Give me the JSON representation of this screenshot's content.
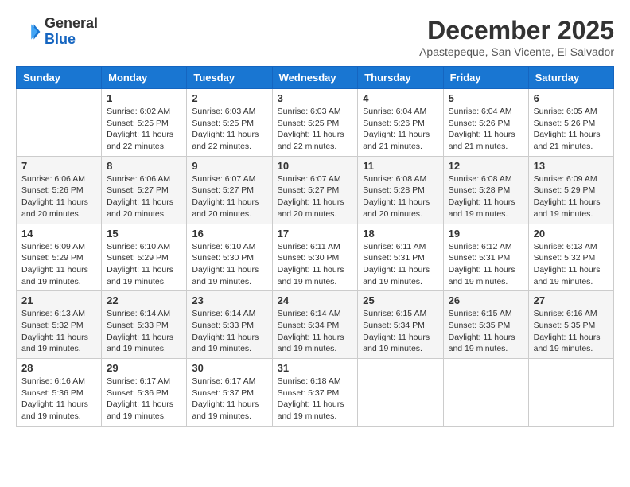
{
  "header": {
    "logo_general": "General",
    "logo_blue": "Blue",
    "month_title": "December 2025",
    "location": "Apastepeque, San Vicente, El Salvador"
  },
  "weekdays": [
    "Sunday",
    "Monday",
    "Tuesday",
    "Wednesday",
    "Thursday",
    "Friday",
    "Saturday"
  ],
  "weeks": [
    [
      {
        "day": "",
        "sunrise": "",
        "sunset": "",
        "daylight": ""
      },
      {
        "day": "1",
        "sunrise": "Sunrise: 6:02 AM",
        "sunset": "Sunset: 5:25 PM",
        "daylight": "Daylight: 11 hours and 22 minutes."
      },
      {
        "day": "2",
        "sunrise": "Sunrise: 6:03 AM",
        "sunset": "Sunset: 5:25 PM",
        "daylight": "Daylight: 11 hours and 22 minutes."
      },
      {
        "day": "3",
        "sunrise": "Sunrise: 6:03 AM",
        "sunset": "Sunset: 5:25 PM",
        "daylight": "Daylight: 11 hours and 22 minutes."
      },
      {
        "day": "4",
        "sunrise": "Sunrise: 6:04 AM",
        "sunset": "Sunset: 5:26 PM",
        "daylight": "Daylight: 11 hours and 21 minutes."
      },
      {
        "day": "5",
        "sunrise": "Sunrise: 6:04 AM",
        "sunset": "Sunset: 5:26 PM",
        "daylight": "Daylight: 11 hours and 21 minutes."
      },
      {
        "day": "6",
        "sunrise": "Sunrise: 6:05 AM",
        "sunset": "Sunset: 5:26 PM",
        "daylight": "Daylight: 11 hours and 21 minutes."
      }
    ],
    [
      {
        "day": "7",
        "sunrise": "Sunrise: 6:06 AM",
        "sunset": "Sunset: 5:26 PM",
        "daylight": "Daylight: 11 hours and 20 minutes."
      },
      {
        "day": "8",
        "sunrise": "Sunrise: 6:06 AM",
        "sunset": "Sunset: 5:27 PM",
        "daylight": "Daylight: 11 hours and 20 minutes."
      },
      {
        "day": "9",
        "sunrise": "Sunrise: 6:07 AM",
        "sunset": "Sunset: 5:27 PM",
        "daylight": "Daylight: 11 hours and 20 minutes."
      },
      {
        "day": "10",
        "sunrise": "Sunrise: 6:07 AM",
        "sunset": "Sunset: 5:27 PM",
        "daylight": "Daylight: 11 hours and 20 minutes."
      },
      {
        "day": "11",
        "sunrise": "Sunrise: 6:08 AM",
        "sunset": "Sunset: 5:28 PM",
        "daylight": "Daylight: 11 hours and 20 minutes."
      },
      {
        "day": "12",
        "sunrise": "Sunrise: 6:08 AM",
        "sunset": "Sunset: 5:28 PM",
        "daylight": "Daylight: 11 hours and 19 minutes."
      },
      {
        "day": "13",
        "sunrise": "Sunrise: 6:09 AM",
        "sunset": "Sunset: 5:29 PM",
        "daylight": "Daylight: 11 hours and 19 minutes."
      }
    ],
    [
      {
        "day": "14",
        "sunrise": "Sunrise: 6:09 AM",
        "sunset": "Sunset: 5:29 PM",
        "daylight": "Daylight: 11 hours and 19 minutes."
      },
      {
        "day": "15",
        "sunrise": "Sunrise: 6:10 AM",
        "sunset": "Sunset: 5:29 PM",
        "daylight": "Daylight: 11 hours and 19 minutes."
      },
      {
        "day": "16",
        "sunrise": "Sunrise: 6:10 AM",
        "sunset": "Sunset: 5:30 PM",
        "daylight": "Daylight: 11 hours and 19 minutes."
      },
      {
        "day": "17",
        "sunrise": "Sunrise: 6:11 AM",
        "sunset": "Sunset: 5:30 PM",
        "daylight": "Daylight: 11 hours and 19 minutes."
      },
      {
        "day": "18",
        "sunrise": "Sunrise: 6:11 AM",
        "sunset": "Sunset: 5:31 PM",
        "daylight": "Daylight: 11 hours and 19 minutes."
      },
      {
        "day": "19",
        "sunrise": "Sunrise: 6:12 AM",
        "sunset": "Sunset: 5:31 PM",
        "daylight": "Daylight: 11 hours and 19 minutes."
      },
      {
        "day": "20",
        "sunrise": "Sunrise: 6:13 AM",
        "sunset": "Sunset: 5:32 PM",
        "daylight": "Daylight: 11 hours and 19 minutes."
      }
    ],
    [
      {
        "day": "21",
        "sunrise": "Sunrise: 6:13 AM",
        "sunset": "Sunset: 5:32 PM",
        "daylight": "Daylight: 11 hours and 19 minutes."
      },
      {
        "day": "22",
        "sunrise": "Sunrise: 6:14 AM",
        "sunset": "Sunset: 5:33 PM",
        "daylight": "Daylight: 11 hours and 19 minutes."
      },
      {
        "day": "23",
        "sunrise": "Sunrise: 6:14 AM",
        "sunset": "Sunset: 5:33 PM",
        "daylight": "Daylight: 11 hours and 19 minutes."
      },
      {
        "day": "24",
        "sunrise": "Sunrise: 6:14 AM",
        "sunset": "Sunset: 5:34 PM",
        "daylight": "Daylight: 11 hours and 19 minutes."
      },
      {
        "day": "25",
        "sunrise": "Sunrise: 6:15 AM",
        "sunset": "Sunset: 5:34 PM",
        "daylight": "Daylight: 11 hours and 19 minutes."
      },
      {
        "day": "26",
        "sunrise": "Sunrise: 6:15 AM",
        "sunset": "Sunset: 5:35 PM",
        "daylight": "Daylight: 11 hours and 19 minutes."
      },
      {
        "day": "27",
        "sunrise": "Sunrise: 6:16 AM",
        "sunset": "Sunset: 5:35 PM",
        "daylight": "Daylight: 11 hours and 19 minutes."
      }
    ],
    [
      {
        "day": "28",
        "sunrise": "Sunrise: 6:16 AM",
        "sunset": "Sunset: 5:36 PM",
        "daylight": "Daylight: 11 hours and 19 minutes."
      },
      {
        "day": "29",
        "sunrise": "Sunrise: 6:17 AM",
        "sunset": "Sunset: 5:36 PM",
        "daylight": "Daylight: 11 hours and 19 minutes."
      },
      {
        "day": "30",
        "sunrise": "Sunrise: 6:17 AM",
        "sunset": "Sunset: 5:37 PM",
        "daylight": "Daylight: 11 hours and 19 minutes."
      },
      {
        "day": "31",
        "sunrise": "Sunrise: 6:18 AM",
        "sunset": "Sunset: 5:37 PM",
        "daylight": "Daylight: 11 hours and 19 minutes."
      },
      {
        "day": "",
        "sunrise": "",
        "sunset": "",
        "daylight": ""
      },
      {
        "day": "",
        "sunrise": "",
        "sunset": "",
        "daylight": ""
      },
      {
        "day": "",
        "sunrise": "",
        "sunset": "",
        "daylight": ""
      }
    ]
  ]
}
